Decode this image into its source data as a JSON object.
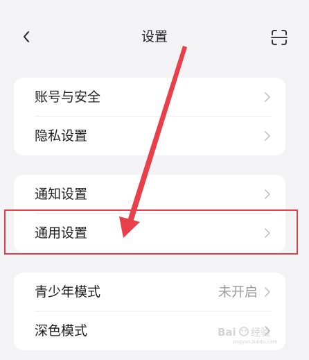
{
  "header": {
    "title": "设置",
    "back_icon": "chevron-left-icon",
    "scan_icon": "scan-icon"
  },
  "groups": [
    {
      "items": [
        {
          "label": "账号与安全",
          "value": ""
        },
        {
          "label": "隐私设置",
          "value": ""
        }
      ]
    },
    {
      "items": [
        {
          "label": "通知设置",
          "value": ""
        },
        {
          "label": "通用设置",
          "value": ""
        }
      ]
    },
    {
      "items": [
        {
          "label": "青少年模式",
          "value": "未开启"
        },
        {
          "label": "深色模式",
          "value": ""
        }
      ]
    }
  ],
  "annotation": {
    "color": "#e8404a",
    "target": "通用设置"
  },
  "watermark": {
    "text": "Baidu经验",
    "subtext": "jingyan.baidu.com"
  },
  "colors": {
    "background": "#f3f3f5",
    "card": "#ffffff",
    "chevron": "#c2c2c2",
    "value_text": "#9a9a9a"
  }
}
